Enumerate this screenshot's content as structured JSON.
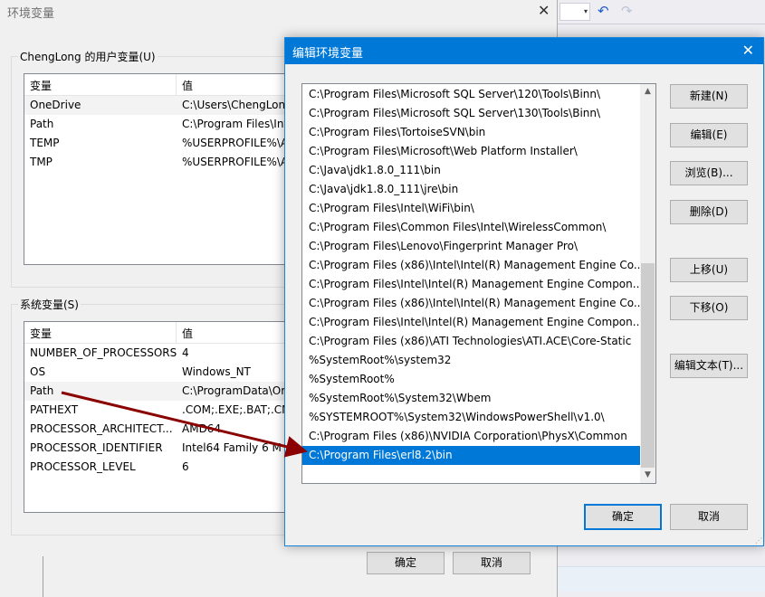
{
  "background": {
    "undo_icon": "↶",
    "redo_icon": "↷",
    "combo_arrow": "▾"
  },
  "env_dialog": {
    "title": "环境变量",
    "close_glyph": "✕",
    "user_group_label": "ChengLong 的用户变量(U)",
    "user_table": {
      "headers": [
        "变量",
        "值"
      ],
      "rows": [
        {
          "name": "OneDrive",
          "value": "C:\\Users\\ChengLon"
        },
        {
          "name": "Path",
          "value": "C:\\Program Files\\Int"
        },
        {
          "name": "TEMP",
          "value": "%USERPROFILE%\\A"
        },
        {
          "name": "TMP",
          "value": "%USERPROFILE%\\A"
        }
      ]
    },
    "system_group_label": "系统变量(S)",
    "system_table": {
      "headers": [
        "变量",
        "值"
      ],
      "rows": [
        {
          "name": "NUMBER_OF_PROCESSORS",
          "value": "4"
        },
        {
          "name": "OS",
          "value": "Windows_NT"
        },
        {
          "name": "Path",
          "value": "C:\\ProgramData\\Or"
        },
        {
          "name": "PATHEXT",
          "value": ".COM;.EXE;.BAT;.CM"
        },
        {
          "name": "PROCESSOR_ARCHITECT...",
          "value": "AMD64"
        },
        {
          "name": "PROCESSOR_IDENTIFIER",
          "value": "Intel64 Family 6 M"
        },
        {
          "name": "PROCESSOR_LEVEL",
          "value": "6"
        }
      ]
    },
    "ok_label": "确定",
    "cancel_label": "取消"
  },
  "edit_dialog": {
    "title": "编辑环境变量",
    "close_glyph": "✕",
    "paths": [
      "C:\\Program Files\\Microsoft SQL Server\\120\\Tools\\Binn\\",
      "C:\\Program Files\\Microsoft SQL Server\\130\\Tools\\Binn\\",
      "C:\\Program Files\\TortoiseSVN\\bin",
      "C:\\Program Files\\Microsoft\\Web Platform Installer\\",
      "C:\\Java\\jdk1.8.0_111\\bin",
      "C:\\Java\\jdk1.8.0_111\\jre\\bin",
      "C:\\Program Files\\Intel\\WiFi\\bin\\",
      "C:\\Program Files\\Common Files\\Intel\\WirelessCommon\\",
      "C:\\Program Files\\Lenovo\\Fingerprint Manager Pro\\",
      "C:\\Program Files (x86)\\Intel\\Intel(R) Management Engine Co...",
      "C:\\Program Files\\Intel\\Intel(R) Management Engine Compon...",
      "C:\\Program Files (x86)\\Intel\\Intel(R) Management Engine Co...",
      "C:\\Program Files\\Intel\\Intel(R) Management Engine Compon...",
      "C:\\Program Files (x86)\\ATI Technologies\\ATI.ACE\\Core-Static",
      "%SystemRoot%\\system32",
      "%SystemRoot%",
      "%SystemRoot%\\System32\\Wbem",
      "%SYSTEMROOT%\\System32\\WindowsPowerShell\\v1.0\\",
      "C:\\Program Files (x86)\\NVIDIA Corporation\\PhysX\\Common",
      "C:\\Program Files\\erl8.2\\bin"
    ],
    "selected_index": 19,
    "scroll_up_glyph": "▲",
    "scroll_down_glyph": "▼",
    "buttons": {
      "new": "新建(N)",
      "edit": "编辑(E)",
      "browse": "浏览(B)...",
      "delete": "删除(D)",
      "move_up": "上移(U)",
      "move_down": "下移(O)",
      "edit_text": "编辑文本(T)..."
    },
    "ok_label": "确定",
    "cancel_label": "取消"
  },
  "colors": {
    "accent": "#0078d7",
    "annotation_arrow": "#8b0000"
  }
}
